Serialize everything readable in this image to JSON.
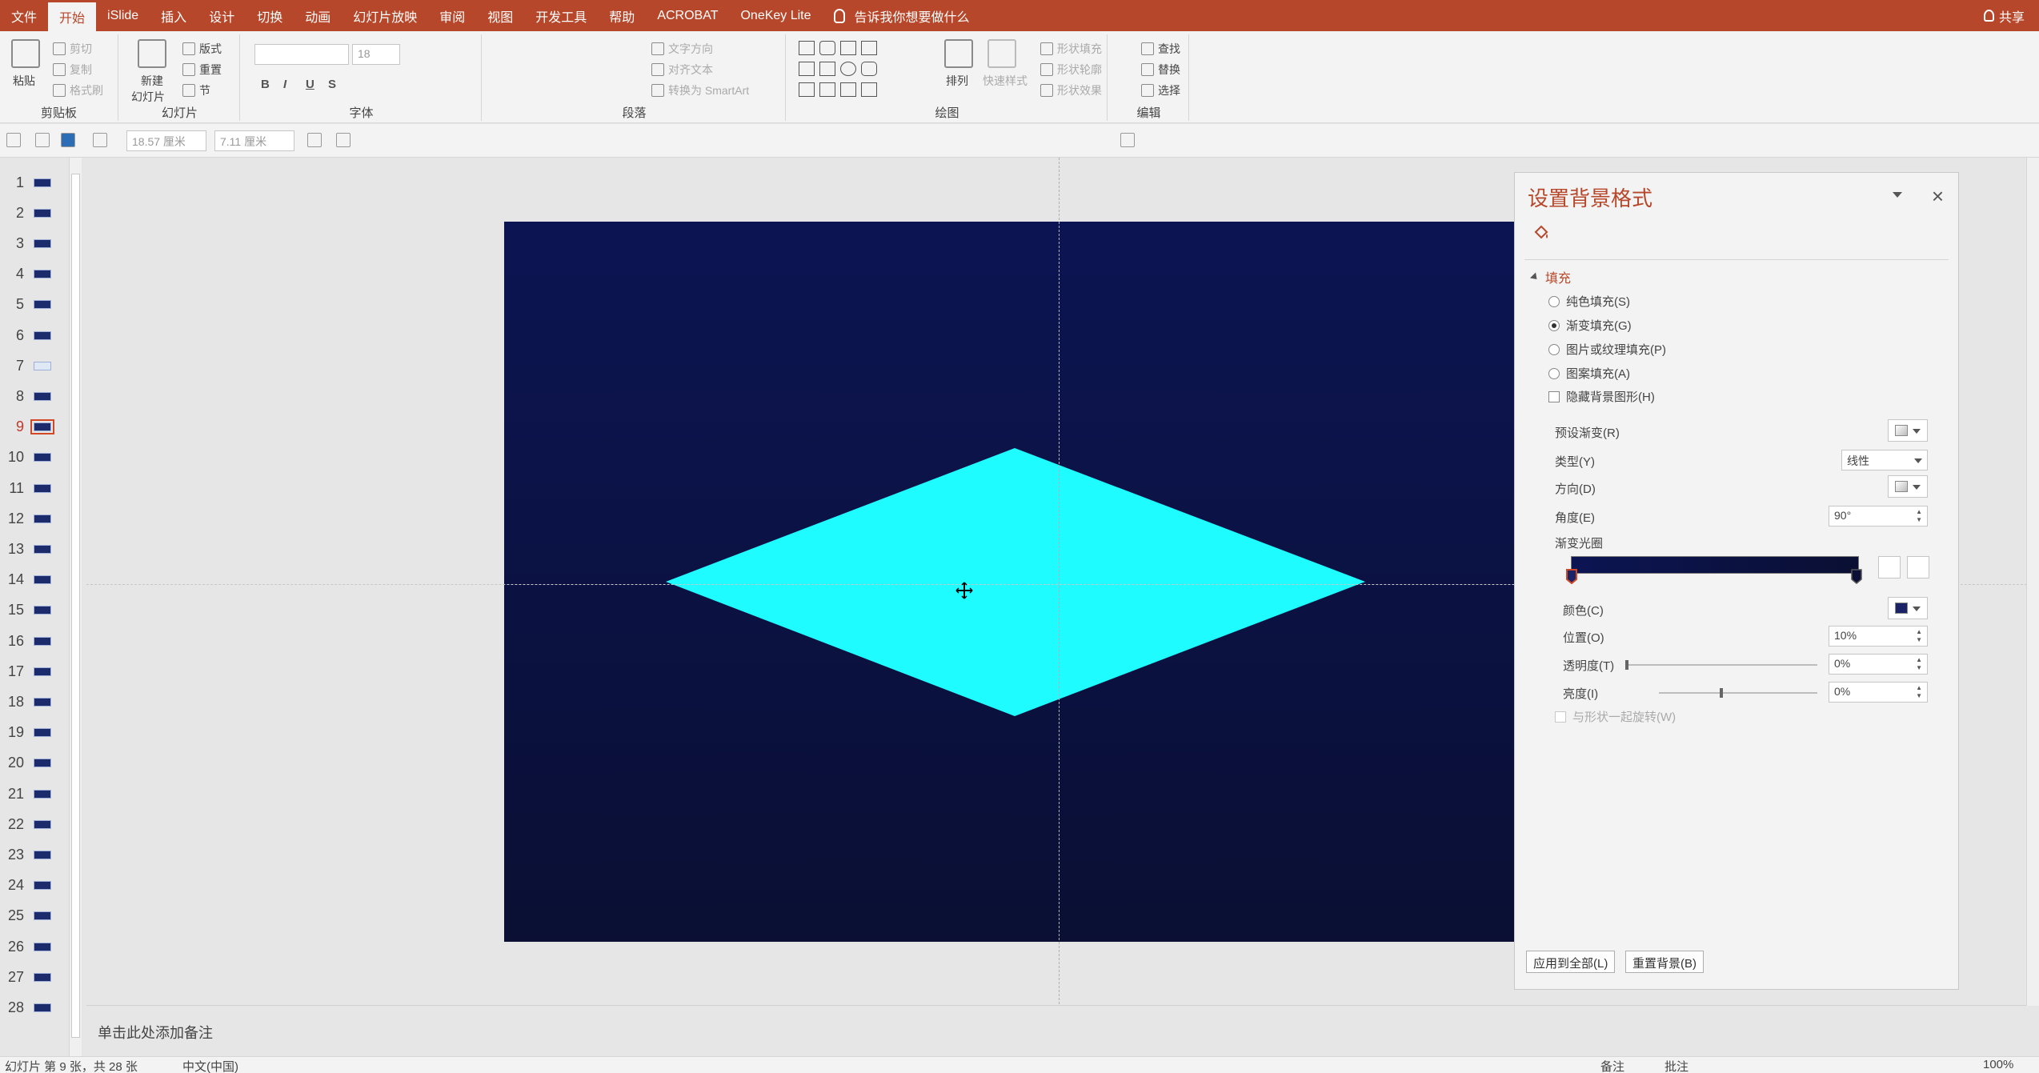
{
  "tabs": [
    "文件",
    "开始",
    "iSlide",
    "插入",
    "设计",
    "切换",
    "动画",
    "幻灯片放映",
    "审阅",
    "视图",
    "开发工具",
    "帮助",
    "ACROBAT",
    "OneKey Lite"
  ],
  "active_tab": "开始",
  "tell_me": "告诉我你想要做什么",
  "share": "共享",
  "ribbon": {
    "clipboard": {
      "paste": "粘贴",
      "cut": "剪切",
      "copy": "复制",
      "format_painter": "格式刷",
      "label": "剪贴板"
    },
    "slides": {
      "new_slide": "新建",
      "new_slide2": "幻灯片",
      "layout": "版式",
      "reset": "重置",
      "section": "节",
      "label": "幻灯片"
    },
    "font": {
      "size": "18",
      "bold": "B",
      "italic": "I",
      "underline": "U",
      "strike": "S",
      "label": "字体"
    },
    "paragraph": {
      "text_dir": "文字方向",
      "align_text": "对齐文本",
      "smartart": "转换为 SmartArt",
      "label": "段落"
    },
    "drawing": {
      "arrange": "排列",
      "quick_styles": "快速样式",
      "shape_fill": "形状填充",
      "shape_outline": "形状轮廓",
      "shape_effects": "形状效果",
      "label": "绘图"
    },
    "editing": {
      "find": "查找",
      "replace": "替换",
      "select": "选择",
      "label": "编辑"
    }
  },
  "qat": {
    "width": "18.57 厘米",
    "height": "7.11 厘米"
  },
  "thumbnails": {
    "numbers": [
      "1",
      "2",
      "3",
      "4",
      "5",
      "6",
      "7",
      "8",
      "9",
      "10",
      "11",
      "12",
      "13",
      "14",
      "15",
      "16",
      "17",
      "18",
      "19",
      "20",
      "21",
      "22",
      "23",
      "24",
      "25",
      "26",
      "27",
      "28"
    ],
    "current": "9"
  },
  "notes_placeholder": "单击此处添加备注",
  "status": {
    "slide_info": "幻灯片 第 9 张，共 28 张",
    "language": "中文(中国)",
    "notes": "备注",
    "comments": "批注",
    "zoom": "100%"
  },
  "slide": {
    "bg_top_color": "#0c1553",
    "bg_bottom_color": "#0a0f33",
    "shape_color": "#1ffcff"
  },
  "pane": {
    "title": "设置背景格式",
    "section": "填充",
    "options": [
      "纯色填充(S)",
      "渐变填充(G)",
      "图片或纹理填充(P)",
      "图案填充(A)"
    ],
    "selected_option": "渐变填充(G)",
    "hide_bg": "隐藏背景图形(H)",
    "preset": "预设渐变(R)",
    "type_label": "类型(Y)",
    "type_value": "线性",
    "direction": "方向(D)",
    "angle_label": "角度(E)",
    "angle_value": "90°",
    "stops_label": "渐变光圈",
    "color_label": "颜色(C)",
    "position_label": "位置(O)",
    "position_value": "10%",
    "transparency_label": "透明度(T)",
    "transparency_value": "0%",
    "brightness_label": "亮度(I)",
    "brightness_value": "0%",
    "rotate_with_shape": "与形状一起旋转(W)",
    "apply_all": "应用到全部(L)",
    "reset_bg": "重置背景(B)"
  }
}
